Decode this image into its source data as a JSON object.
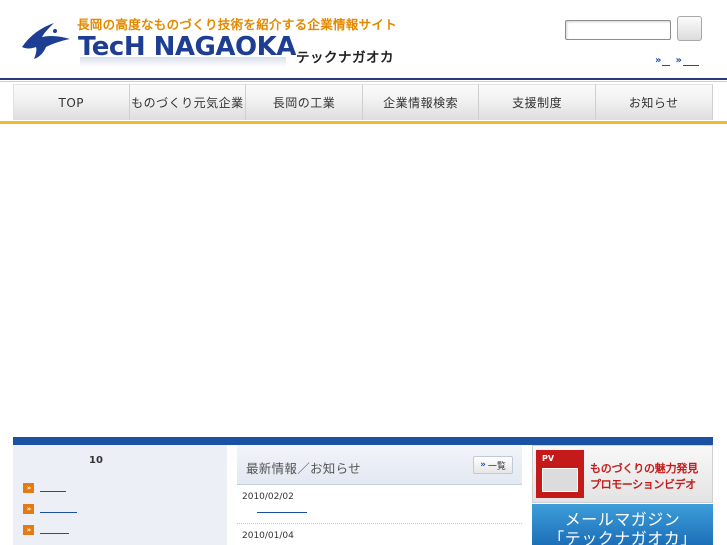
{
  "header": {
    "tagline": "長岡の高度なものづくり技術を紹介する企業情報サイト",
    "logo_text": "TecH NAGAOKA",
    "logo_kana": "テックナガオカ",
    "search": {
      "value": "",
      "placeholder": ""
    },
    "util_links": [
      "»",
      "»"
    ]
  },
  "nav": {
    "items": [
      "TOP",
      "ものづくり元気企業",
      "長岡の工業",
      "企業情報検索",
      "支援制度",
      "お知らせ"
    ]
  },
  "left_panel": {
    "title": "10",
    "arrow": "»"
  },
  "news": {
    "title": "最新情報／お知らせ",
    "all_label": "一覧",
    "all_arrow": "»",
    "items": [
      {
        "date": "2010/02/02"
      },
      {
        "date": "2010/01/04"
      }
    ]
  },
  "banners": {
    "pv": {
      "badge": "PV",
      "line1": "ものづくりの魅力発見",
      "line2": "プロモーションビデオ"
    },
    "mail": {
      "line1": "メールマガジン",
      "line2": "「テックナガオカ」"
    }
  },
  "colors": {
    "brand_blue": "#1d3e92",
    "tagline_orange": "#e38a00",
    "accent_bar": "#1a51a3",
    "nav_underline": "#f0b833",
    "pv_red": "#c41a1a"
  }
}
